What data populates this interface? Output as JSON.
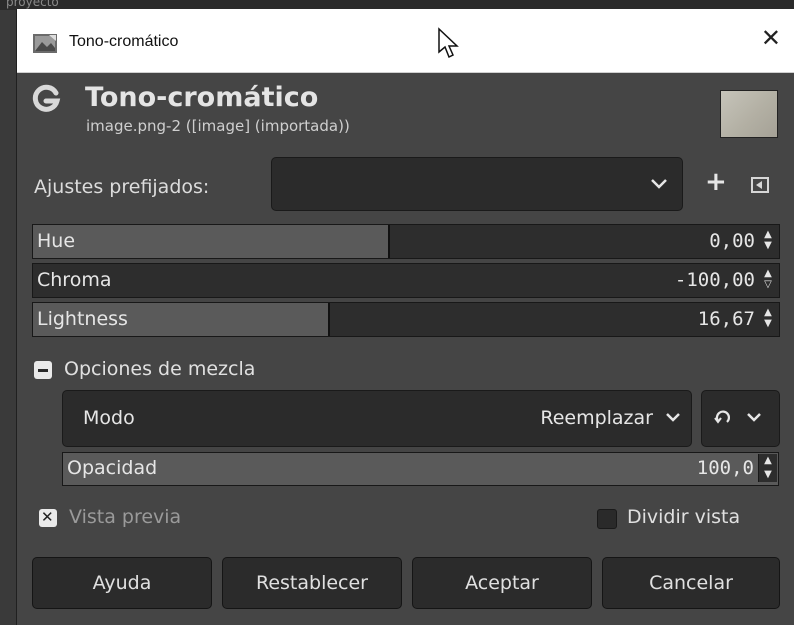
{
  "background_window": {
    "title_fragment": "proyecto"
  },
  "titlebar": {
    "title": "Tono-cromático",
    "close_glyph": "✕"
  },
  "header": {
    "title": "Tono-cromático",
    "subtitle": "image.png-2 ([image] (importada))",
    "logo_letter": "G"
  },
  "presets": {
    "label": "Ajustes prefijados:",
    "value": "",
    "add_glyph": "+"
  },
  "sliders": [
    {
      "label": "Hue",
      "value": "0,00",
      "fill_fraction": 0.5
    },
    {
      "label": "Chroma",
      "value": "-100,00",
      "fill_fraction": 0.0
    },
    {
      "label": "Lightness",
      "value": "16,67",
      "fill_fraction": 0.4
    }
  ],
  "blend": {
    "header": "Opciones de mezcla",
    "mode_label": "Modo",
    "mode_value": "Reemplazar",
    "opacity_label": "Opacidad",
    "opacity_value": "100,0"
  },
  "preview": {
    "label": "Vista previa",
    "checked": true
  },
  "split": {
    "label": "Dividir vista",
    "checked": false
  },
  "buttons": {
    "help": "Ayuda",
    "reset": "Restablecer",
    "ok": "Aceptar",
    "cancel": "Cancelar"
  },
  "colors": {
    "window_bg": "#454545",
    "field_bg": "#2b2b2b",
    "slider_fill": "#5a5a5a",
    "text": "#e6e6e6"
  },
  "icons": [
    "gimp-logo-icon",
    "close-icon",
    "chevron-down-icon",
    "plus-icon",
    "menu-icon",
    "reset-icon",
    "spin-icon",
    "checkbox-icon"
  ]
}
